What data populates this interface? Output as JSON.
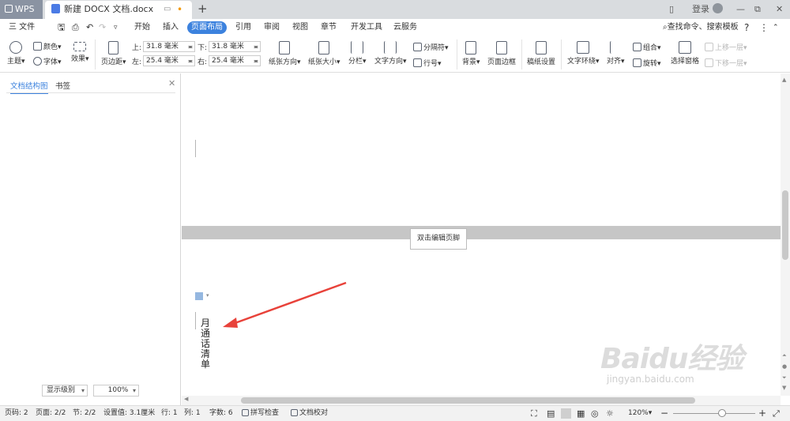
{
  "titlebar": {
    "app_name": "WPS",
    "doc_tab": "新建 DOCX 文档.docx",
    "new_tab": "+",
    "login": "登录",
    "win_min": "—",
    "win_restore": "⧉",
    "win_close": "✕"
  },
  "ribbon": {
    "file_menu": "三 文件",
    "tabs": [
      "开始",
      "插入",
      "页面布局",
      "引用",
      "审阅",
      "视图",
      "章节",
      "开发工具",
      "云服务"
    ],
    "search": "查找命令、搜索模板",
    "help": "?"
  },
  "toolbar": {
    "theme": "主题",
    "color": "颜色",
    "font": "字体",
    "effect": "效果",
    "page_margin": "页边距",
    "top_label": "上:",
    "top_value": "31.8 毫米",
    "bottom_label": "下:",
    "bottom_value": "31.8 毫米",
    "left_label": "左:",
    "left_value": "25.4 毫米",
    "right_label": "右:",
    "right_value": "25.4 毫米",
    "orientation": "纸张方向",
    "paper_size": "纸张大小",
    "columns": "分栏",
    "text_direction": "文字方向",
    "separator": "分隔符",
    "line_number": "行号",
    "background": "背景",
    "page_border": "页面边框",
    "draft_setting": "稿纸设置",
    "text_wrap": "文字环绕",
    "align": "对齐",
    "group": "组合",
    "rotate": "旋转",
    "select_pane": "选择窗格",
    "bring_forward": "上移一层",
    "send_backward": "下移一层"
  },
  "panel": {
    "tab_outline": "文档结构图",
    "tab_bookmark": "书签",
    "level_select": "显示级别",
    "zoom_select": "100%"
  },
  "document": {
    "footer_hint": "双击编辑页脚",
    "vertical_text": "月通话清单"
  },
  "status": {
    "page_no": "页码: 2",
    "pages": "页面: 2/2",
    "section": "节: 2/2",
    "setting": "设置值: 3.1厘米",
    "row": "行: 1",
    "col": "列: 1",
    "word_count": "字数: 6",
    "spell_check": "拼写检查",
    "doc_proof": "文档校对",
    "zoom_value": "120%",
    "zoom_level": 0.6
  },
  "watermark": {
    "brand": "Baidu经验",
    "url": "jingyan.baidu.com"
  },
  "colors": {
    "accent": "#3c82de",
    "arrow": "#e8423a"
  }
}
